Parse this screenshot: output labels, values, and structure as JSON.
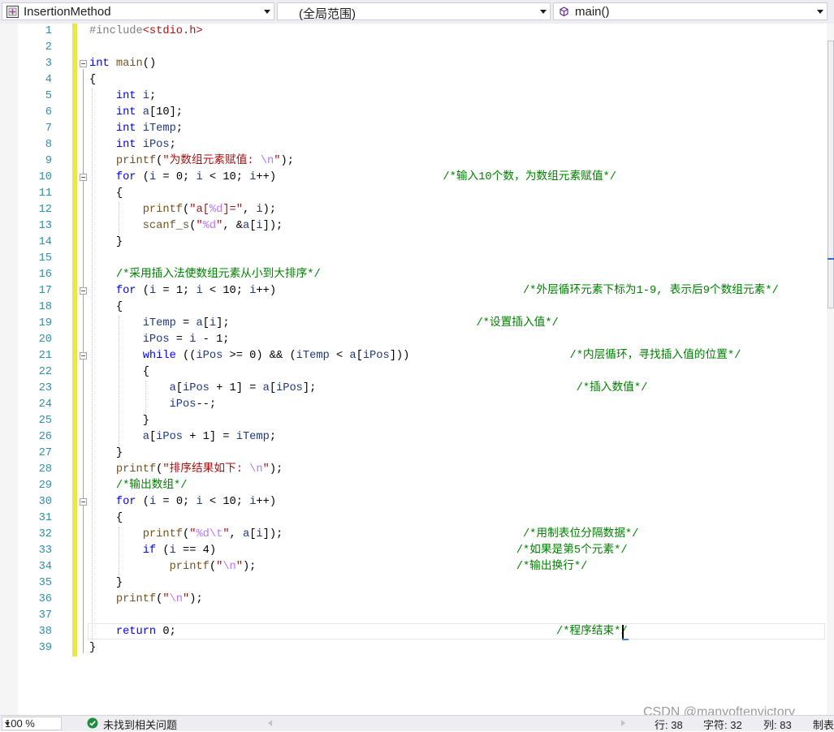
{
  "navbar": {
    "project": "InsertionMethod",
    "scope": "(全局范围)",
    "member": "main()"
  },
  "editor": {
    "lines": [
      {
        "num": "1",
        "tokens": [
          {
            "t": "pp",
            "v": "#include"
          },
          {
            "t": "inc",
            "v": "<stdio.h>"
          }
        ]
      },
      {
        "num": "2",
        "tokens": []
      },
      {
        "num": "3",
        "tokens": [
          {
            "t": "kw",
            "v": "int"
          },
          {
            "t": "id",
            "v": " "
          },
          {
            "t": "fn",
            "v": "main"
          },
          {
            "t": "id",
            "v": "()"
          }
        ]
      },
      {
        "num": "4",
        "tokens": [
          {
            "t": "id",
            "v": "{"
          }
        ]
      },
      {
        "num": "5",
        "tokens": [
          {
            "t": "id",
            "v": "    "
          },
          {
            "t": "kw",
            "v": "int"
          },
          {
            "t": "id",
            "v": " "
          },
          {
            "t": "lv",
            "v": "i"
          },
          {
            "t": "id",
            "v": ";"
          }
        ]
      },
      {
        "num": "6",
        "tokens": [
          {
            "t": "id",
            "v": "    "
          },
          {
            "t": "kw",
            "v": "int"
          },
          {
            "t": "id",
            "v": " "
          },
          {
            "t": "lv",
            "v": "a"
          },
          {
            "t": "id",
            "v": "[10];"
          }
        ]
      },
      {
        "num": "7",
        "tokens": [
          {
            "t": "id",
            "v": "    "
          },
          {
            "t": "kw",
            "v": "int"
          },
          {
            "t": "id",
            "v": " "
          },
          {
            "t": "lv",
            "v": "iTemp"
          },
          {
            "t": "id",
            "v": ";"
          }
        ]
      },
      {
        "num": "8",
        "tokens": [
          {
            "t": "id",
            "v": "    "
          },
          {
            "t": "kw",
            "v": "int"
          },
          {
            "t": "id",
            "v": " "
          },
          {
            "t": "lv",
            "v": "iPos"
          },
          {
            "t": "id",
            "v": ";"
          }
        ]
      },
      {
        "num": "9",
        "tokens": [
          {
            "t": "id",
            "v": "    "
          },
          {
            "t": "fn",
            "v": "printf"
          },
          {
            "t": "id",
            "v": "("
          },
          {
            "t": "str",
            "v": "\"为数组元素赋值: "
          },
          {
            "t": "esc",
            "v": "\\n"
          },
          {
            "t": "str",
            "v": "\""
          },
          {
            "t": "id",
            "v": ");"
          }
        ]
      },
      {
        "num": "10",
        "tokens": [
          {
            "t": "id",
            "v": "    "
          },
          {
            "t": "kw",
            "v": "for"
          },
          {
            "t": "id",
            "v": " ("
          },
          {
            "t": "lv",
            "v": "i"
          },
          {
            "t": "id",
            "v": " = 0; "
          },
          {
            "t": "lv",
            "v": "i"
          },
          {
            "t": "id",
            "v": " < 10; "
          },
          {
            "t": "lv",
            "v": "i"
          },
          {
            "t": "id",
            "v": "++)                         "
          },
          {
            "t": "cm",
            "v": "/*输入10个数，为数组元素赋值*/"
          }
        ]
      },
      {
        "num": "11",
        "tokens": [
          {
            "t": "id",
            "v": "    {"
          }
        ]
      },
      {
        "num": "12",
        "tokens": [
          {
            "t": "id",
            "v": "        "
          },
          {
            "t": "fn",
            "v": "printf"
          },
          {
            "t": "id",
            "v": "("
          },
          {
            "t": "str",
            "v": "\"a["
          },
          {
            "t": "esc",
            "v": "%d"
          },
          {
            "t": "str",
            "v": "]=\""
          },
          {
            "t": "id",
            "v": ", "
          },
          {
            "t": "lv",
            "v": "i"
          },
          {
            "t": "id",
            "v": ");"
          }
        ]
      },
      {
        "num": "13",
        "tokens": [
          {
            "t": "id",
            "v": "        "
          },
          {
            "t": "fn",
            "v": "scanf_s"
          },
          {
            "t": "id",
            "v": "("
          },
          {
            "t": "str",
            "v": "\""
          },
          {
            "t": "esc",
            "v": "%d"
          },
          {
            "t": "str",
            "v": "\""
          },
          {
            "t": "id",
            "v": ", &"
          },
          {
            "t": "lv",
            "v": "a"
          },
          {
            "t": "id",
            "v": "["
          },
          {
            "t": "lv",
            "v": "i"
          },
          {
            "t": "id",
            "v": "]);"
          }
        ]
      },
      {
        "num": "14",
        "tokens": [
          {
            "t": "id",
            "v": "    }"
          }
        ]
      },
      {
        "num": "15",
        "tokens": []
      },
      {
        "num": "16",
        "tokens": [
          {
            "t": "id",
            "v": "    "
          },
          {
            "t": "cm",
            "v": "/*采用插入法使数组元素从小到大排序*/"
          }
        ]
      },
      {
        "num": "17",
        "tokens": [
          {
            "t": "id",
            "v": "    "
          },
          {
            "t": "kw",
            "v": "for"
          },
          {
            "t": "id",
            "v": " ("
          },
          {
            "t": "lv",
            "v": "i"
          },
          {
            "t": "id",
            "v": " = 1; "
          },
          {
            "t": "lv",
            "v": "i"
          },
          {
            "t": "id",
            "v": " < 10; "
          },
          {
            "t": "lv",
            "v": "i"
          },
          {
            "t": "id",
            "v": "++)                                     "
          },
          {
            "t": "cm",
            "v": "/*外层循环元素下标为1-9, 表示后9个数组元素*/"
          }
        ]
      },
      {
        "num": "18",
        "tokens": [
          {
            "t": "id",
            "v": "    {"
          }
        ]
      },
      {
        "num": "19",
        "tokens": [
          {
            "t": "id",
            "v": "        "
          },
          {
            "t": "lv",
            "v": "iTemp"
          },
          {
            "t": "id",
            "v": " = "
          },
          {
            "t": "lv",
            "v": "a"
          },
          {
            "t": "id",
            "v": "["
          },
          {
            "t": "lv",
            "v": "i"
          },
          {
            "t": "id",
            "v": "];                                     "
          },
          {
            "t": "cm",
            "v": "/*设置插入值*/"
          }
        ]
      },
      {
        "num": "20",
        "tokens": [
          {
            "t": "id",
            "v": "        "
          },
          {
            "t": "lv",
            "v": "iPos"
          },
          {
            "t": "id",
            "v": " = "
          },
          {
            "t": "lv",
            "v": "i"
          },
          {
            "t": "id",
            "v": " - 1;"
          }
        ]
      },
      {
        "num": "21",
        "tokens": [
          {
            "t": "id",
            "v": "        "
          },
          {
            "t": "kw",
            "v": "while"
          },
          {
            "t": "id",
            "v": " (("
          },
          {
            "t": "lv",
            "v": "iPos"
          },
          {
            "t": "id",
            "v": " >= 0) && ("
          },
          {
            "t": "lv",
            "v": "iTemp"
          },
          {
            "t": "id",
            "v": " < "
          },
          {
            "t": "lv",
            "v": "a"
          },
          {
            "t": "id",
            "v": "["
          },
          {
            "t": "lv",
            "v": "iPos"
          },
          {
            "t": "id",
            "v": "]))                        "
          },
          {
            "t": "cm",
            "v": "/*内层循环，寻找插入值的位置*/"
          }
        ]
      },
      {
        "num": "22",
        "tokens": [
          {
            "t": "id",
            "v": "        {"
          }
        ]
      },
      {
        "num": "23",
        "tokens": [
          {
            "t": "id",
            "v": "            "
          },
          {
            "t": "lv",
            "v": "a"
          },
          {
            "t": "id",
            "v": "["
          },
          {
            "t": "lv",
            "v": "iPos"
          },
          {
            "t": "id",
            "v": " + 1] = "
          },
          {
            "t": "lv",
            "v": "a"
          },
          {
            "t": "id",
            "v": "["
          },
          {
            "t": "lv",
            "v": "iPos"
          },
          {
            "t": "id",
            "v": "];                                       "
          },
          {
            "t": "cm",
            "v": "/*插入数值*/"
          }
        ]
      },
      {
        "num": "24",
        "tokens": [
          {
            "t": "id",
            "v": "            "
          },
          {
            "t": "lv",
            "v": "iPos"
          },
          {
            "t": "id",
            "v": "--;"
          }
        ]
      },
      {
        "num": "25",
        "tokens": [
          {
            "t": "id",
            "v": "        }"
          }
        ]
      },
      {
        "num": "26",
        "tokens": [
          {
            "t": "id",
            "v": "        "
          },
          {
            "t": "lv",
            "v": "a"
          },
          {
            "t": "id",
            "v": "["
          },
          {
            "t": "lv",
            "v": "iPos"
          },
          {
            "t": "id",
            "v": " + 1] = "
          },
          {
            "t": "lv",
            "v": "iTemp"
          },
          {
            "t": "id",
            "v": ";"
          }
        ]
      },
      {
        "num": "27",
        "tokens": [
          {
            "t": "id",
            "v": "    }"
          }
        ]
      },
      {
        "num": "28",
        "tokens": [
          {
            "t": "id",
            "v": "    "
          },
          {
            "t": "fn",
            "v": "printf"
          },
          {
            "t": "id",
            "v": "("
          },
          {
            "t": "str",
            "v": "\"排序结果如下: "
          },
          {
            "t": "esc",
            "v": "\\n"
          },
          {
            "t": "str",
            "v": "\""
          },
          {
            "t": "id",
            "v": ");"
          }
        ]
      },
      {
        "num": "29",
        "tokens": [
          {
            "t": "id",
            "v": "    "
          },
          {
            "t": "cm",
            "v": "/*输出数组*/"
          }
        ]
      },
      {
        "num": "30",
        "tokens": [
          {
            "t": "id",
            "v": "    "
          },
          {
            "t": "kw",
            "v": "for"
          },
          {
            "t": "id",
            "v": " ("
          },
          {
            "t": "lv",
            "v": "i"
          },
          {
            "t": "id",
            "v": " = 0; "
          },
          {
            "t": "lv",
            "v": "i"
          },
          {
            "t": "id",
            "v": " < 10; "
          },
          {
            "t": "lv",
            "v": "i"
          },
          {
            "t": "id",
            "v": "++)"
          }
        ]
      },
      {
        "num": "31",
        "tokens": [
          {
            "t": "id",
            "v": "    {"
          }
        ]
      },
      {
        "num": "32",
        "tokens": [
          {
            "t": "id",
            "v": "        "
          },
          {
            "t": "fn",
            "v": "printf"
          },
          {
            "t": "id",
            "v": "("
          },
          {
            "t": "str",
            "v": "\""
          },
          {
            "t": "esc",
            "v": "%d\\t"
          },
          {
            "t": "str",
            "v": "\""
          },
          {
            "t": "id",
            "v": ", "
          },
          {
            "t": "lv",
            "v": "a"
          },
          {
            "t": "id",
            "v": "["
          },
          {
            "t": "lv",
            "v": "i"
          },
          {
            "t": "id",
            "v": "]);                                    "
          },
          {
            "t": "cm",
            "v": "/*用制表位分隔数据*/"
          }
        ]
      },
      {
        "num": "33",
        "tokens": [
          {
            "t": "id",
            "v": "        "
          },
          {
            "t": "kw",
            "v": "if"
          },
          {
            "t": "id",
            "v": " ("
          },
          {
            "t": "lv",
            "v": "i"
          },
          {
            "t": "id",
            "v": " == 4)                                             "
          },
          {
            "t": "cm",
            "v": "/*如果是第5个元素*/"
          }
        ]
      },
      {
        "num": "34",
        "tokens": [
          {
            "t": "id",
            "v": "            "
          },
          {
            "t": "fn",
            "v": "printf"
          },
          {
            "t": "id",
            "v": "("
          },
          {
            "t": "str",
            "v": "\""
          },
          {
            "t": "esc",
            "v": "\\n"
          },
          {
            "t": "str",
            "v": "\""
          },
          {
            "t": "id",
            "v": ");                                       "
          },
          {
            "t": "cm",
            "v": "/*输出换行*/"
          }
        ]
      },
      {
        "num": "35",
        "tokens": [
          {
            "t": "id",
            "v": "    }"
          }
        ]
      },
      {
        "num": "36",
        "tokens": [
          {
            "t": "id",
            "v": "    "
          },
          {
            "t": "fn",
            "v": "printf"
          },
          {
            "t": "id",
            "v": "("
          },
          {
            "t": "str",
            "v": "\""
          },
          {
            "t": "esc",
            "v": "\\n"
          },
          {
            "t": "str",
            "v": "\""
          },
          {
            "t": "id",
            "v": ");"
          }
        ]
      },
      {
        "num": "37",
        "tokens": []
      },
      {
        "num": "38",
        "tokens": [
          {
            "t": "id",
            "v": "    "
          },
          {
            "t": "kw",
            "v": "return"
          },
          {
            "t": "id",
            "v": " 0;                                                         "
          },
          {
            "t": "cm",
            "v": "/*程序结束*/"
          }
        ]
      },
      {
        "num": "39",
        "tokens": [
          {
            "t": "id",
            "v": "}"
          }
        ]
      }
    ]
  },
  "statusbar": {
    "zoom": "100 %",
    "issues": "未找到相关问题",
    "line": "行: 38",
    "char": "字符: 32",
    "col": "列: 83",
    "tab": "制表"
  },
  "watermark": "CSDN @manyoftenvictory",
  "colors": {
    "keyword": "#0000ff",
    "string": "#a31515",
    "escape": "#b776fb",
    "comment": "#008000",
    "line_number": "#2b91af",
    "change_bar": "#eee54a"
  },
  "icons": {
    "project": "cpp-project-icon",
    "member": "method-cube-icon",
    "issues": "check-circle-icon"
  }
}
